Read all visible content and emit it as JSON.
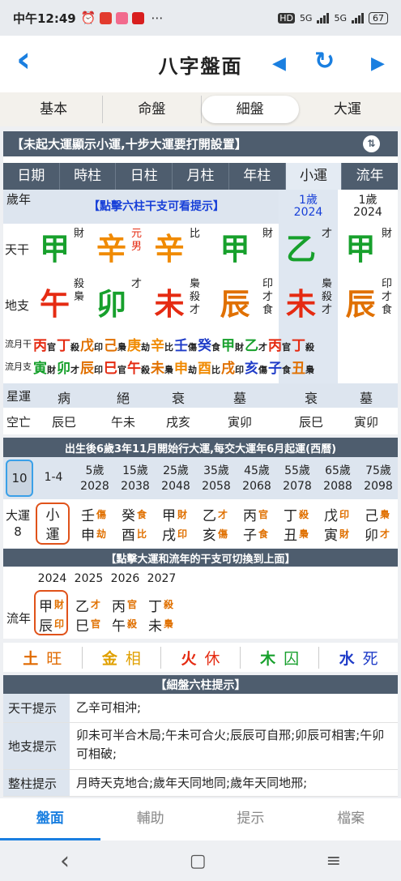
{
  "status": {
    "time": "中午12:49",
    "hd": "HD",
    "net1": "5G",
    "net2": "5G",
    "battery": "67"
  },
  "header": {
    "title": "八字盤面",
    "back": "‹",
    "prev": "◀",
    "refresh": "↻",
    "next": "▶"
  },
  "tabs": [
    "基本",
    "命盤",
    "細盤",
    "大運"
  ],
  "banner1": "【未起大運顯示小運,十步大運要打開設置】",
  "table": {
    "headers": [
      "日期",
      "時柱",
      "日柱",
      "月柱",
      "年柱",
      "小運",
      "流年"
    ],
    "age_label": "歲年",
    "prompt": "【點擊六柱干支可看提示】",
    "xiaoyun_age": "1歲",
    "xiaoyun_year": "2024",
    "liunian_age": "1歲",
    "liunian_year": "2024",
    "tiangan_label": "天干",
    "tiangan": [
      {
        "ch": "甲",
        "side": "財",
        "cls": "c-wood"
      },
      {
        "ch": "辛",
        "side": "元男",
        "cls": "c-metal"
      },
      {
        "ch": "辛",
        "side": "比",
        "cls": "c-metal"
      },
      {
        "ch": "甲",
        "side": "財",
        "cls": "c-wood"
      },
      {
        "ch": "乙",
        "side": "才",
        "cls": "c-wood"
      },
      {
        "ch": "甲",
        "side": "財",
        "cls": "c-wood"
      }
    ],
    "dizhi_label": "地支",
    "dizhi": [
      {
        "ch": "午",
        "side": "殺梟",
        "cls": "c-fire"
      },
      {
        "ch": "卯",
        "side": "才",
        "cls": "c-wood"
      },
      {
        "ch": "未",
        "side": "梟殺才",
        "cls": "c-fire"
      },
      {
        "ch": "辰",
        "side": "印才食",
        "cls": "c-earth"
      },
      {
        "ch": "未",
        "side": "梟殺才",
        "cls": "c-fire"
      },
      {
        "ch": "辰",
        "side": "印才食",
        "cls": "c-earth"
      }
    ],
    "liugan_label": "流月干",
    "liugan": [
      [
        "丙",
        "官"
      ],
      [
        "丁",
        "殺"
      ],
      [
        "戊",
        "印"
      ],
      [
        "己",
        "梟"
      ],
      [
        "庚",
        "劫"
      ],
      [
        "辛",
        "比"
      ],
      [
        "壬",
        "傷"
      ],
      [
        "癸",
        "食"
      ],
      [
        "甲",
        "財"
      ],
      [
        "乙",
        "才"
      ],
      [
        "丙",
        "官"
      ],
      [
        "丁",
        "殺"
      ]
    ],
    "liuzhi_label": "流月支",
    "liuzhi": [
      [
        "寅",
        "財"
      ],
      [
        "卯",
        "才"
      ],
      [
        "辰",
        "印"
      ],
      [
        "巳",
        "官"
      ],
      [
        "午",
        "殺"
      ],
      [
        "未",
        "梟"
      ],
      [
        "申",
        "劫"
      ],
      [
        "酉",
        "比"
      ],
      [
        "戌",
        "印"
      ],
      [
        "亥",
        "傷"
      ],
      [
        "子",
        "食"
      ],
      [
        "丑",
        "梟"
      ]
    ],
    "xingyun_label": "星運",
    "xingyun": [
      "病",
      "絕",
      "衰",
      "墓",
      "衰",
      "墓"
    ],
    "kongwang_label": "空亡",
    "kongwang": [
      "辰巳",
      "午未",
      "戌亥",
      "寅卯",
      "辰巳",
      "寅卯"
    ]
  },
  "banner2": "出生後6歲3年11月開始行大運,每交大運年6月起運(西曆)",
  "dayun": {
    "ages": [
      "10",
      "1-4",
      "5歲",
      "15歲",
      "25歲",
      "35歲",
      "45歲",
      "55歲",
      "65歲",
      "75歲"
    ],
    "years": [
      "",
      "",
      "2028",
      "2038",
      "2048",
      "2058",
      "2068",
      "2078",
      "2088",
      "2098"
    ],
    "label": "大運",
    "label_num": "8",
    "xiaoyun": "小運",
    "pillars": [
      {
        "g": "壬",
        "gs": "傷",
        "z": "申",
        "zs": "劫"
      },
      {
        "g": "癸",
        "gs": "食",
        "z": "酉",
        "zs": "比"
      },
      {
        "g": "甲",
        "gs": "財",
        "z": "戌",
        "zs": "印"
      },
      {
        "g": "乙",
        "gs": "才",
        "z": "亥",
        "zs": "傷"
      },
      {
        "g": "丙",
        "gs": "官",
        "z": "子",
        "zs": "食"
      },
      {
        "g": "丁",
        "gs": "殺",
        "z": "丑",
        "zs": "梟"
      },
      {
        "g": "戊",
        "gs": "印",
        "z": "寅",
        "zs": "財"
      },
      {
        "g": "己",
        "gs": "梟",
        "z": "卯",
        "zs": "才"
      }
    ]
  },
  "banner3": "【點擊大運和流年的干支可切換到上面】",
  "liunian": {
    "label": "流年",
    "years": [
      "2024",
      "2025",
      "2026",
      "2027"
    ],
    "pillars": [
      {
        "g": "甲",
        "gs": "財",
        "z": "辰",
        "zs": "印"
      },
      {
        "g": "乙",
        "gs": "才",
        "z": "巳",
        "zs": "官"
      },
      {
        "g": "丙",
        "gs": "官",
        "z": "午",
        "zs": "殺"
      },
      {
        "g": "丁",
        "gs": "殺",
        "z": "未",
        "zs": "梟"
      }
    ]
  },
  "wuxing": [
    {
      "el": "土",
      "st": "旺",
      "color": "#e06a00"
    },
    {
      "el": "金",
      "st": "相",
      "color": "#e0a000"
    },
    {
      "el": "火",
      "st": "休",
      "color": "#e52b12"
    },
    {
      "el": "木",
      "st": "囚",
      "color": "#17a02c"
    },
    {
      "el": "水",
      "st": "死",
      "color": "#1f3cc8"
    }
  ],
  "banner4": "【細盤六柱提示】",
  "hints": [
    {
      "k": "天干提示",
      "v": "乙辛可相沖;"
    },
    {
      "k": "地支提示",
      "v": "卯未可半合木局;午未可合火;辰辰可自邢;卯辰可相害;午卯可相破;"
    },
    {
      "k": "整柱提示",
      "v": "月時天克地合;歲年天同地同;歲年天同地邢;"
    }
  ],
  "bottomnav": [
    "盤面",
    "輔助",
    "提示",
    "檔案"
  ],
  "sysnav": {
    "back": "‹",
    "home": "▢",
    "menu": "≡"
  }
}
